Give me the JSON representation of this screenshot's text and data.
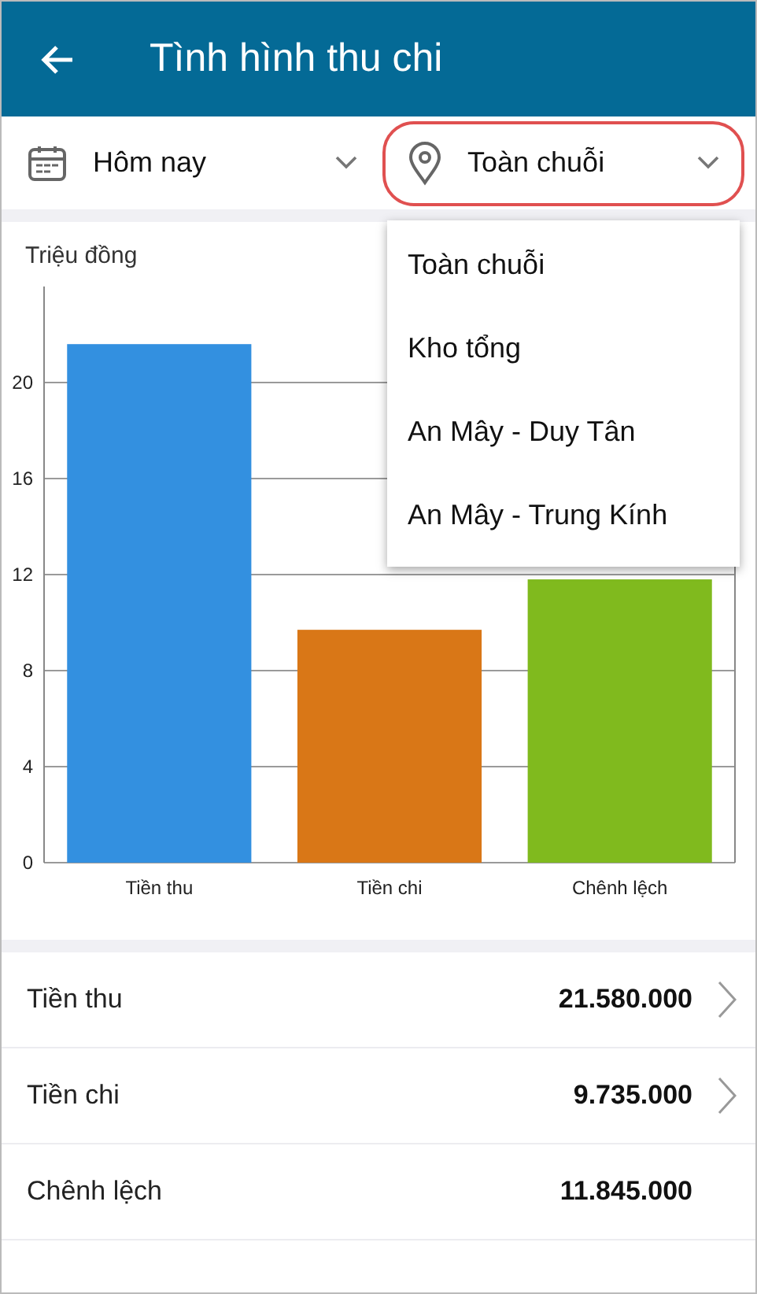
{
  "header": {
    "title": "Tình hình thu chi"
  },
  "filters": [
    {
      "kind": "date",
      "value": "Hôm nay",
      "expanded": false
    },
    {
      "kind": "location",
      "value": "Toàn chuỗi",
      "expanded": true
    }
  ],
  "dropdown_menu": {
    "items": [
      "Toàn chuỗi",
      "Kho tổng",
      "An Mây - Duy Tân",
      "An Mây - Trung Kính"
    ]
  },
  "chart_data": {
    "type": "bar",
    "ylabel": "Triệu đồng",
    "categories": [
      "Tiền thu",
      "Tiền chi",
      "Chênh lệch"
    ],
    "values": [
      21.6,
      9.7,
      11.8
    ],
    "colors": [
      "#3390e0",
      "#d97717",
      "#80ba1e"
    ],
    "grid": true,
    "ylim": [
      0,
      24
    ],
    "yticks": [
      0,
      4,
      8,
      12,
      16,
      20
    ]
  },
  "summary": [
    {
      "label": "Tiền thu",
      "value": "21.580.000",
      "navigable": true
    },
    {
      "label": "Tiền chi",
      "value": "9.735.000",
      "navigable": true
    },
    {
      "label": "Chênh lệch",
      "value": "11.845.000",
      "navigable": false
    }
  ]
}
